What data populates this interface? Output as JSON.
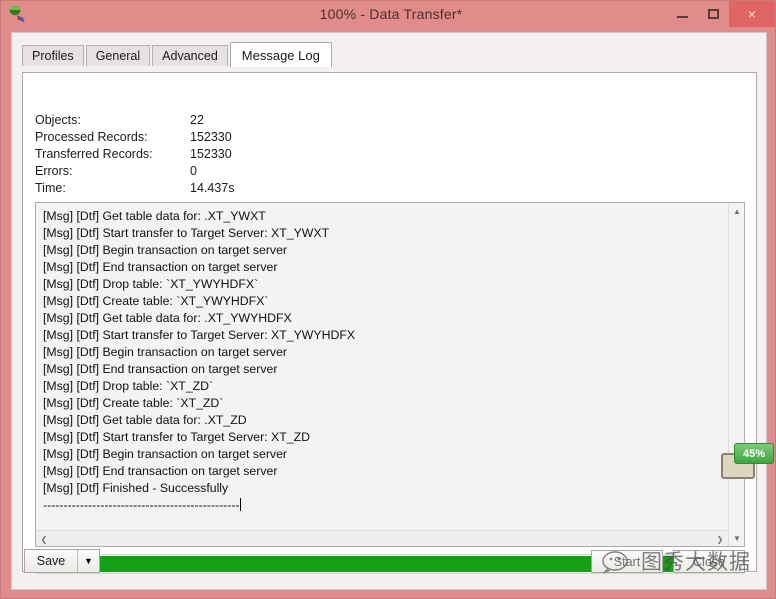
{
  "window": {
    "title": "100% - Data Transfer*",
    "app_icon": "navicat-data-transfer-icon",
    "controls": {
      "minimize": "minimize-icon",
      "maximize": "maximize-icon",
      "close": "×"
    }
  },
  "tabs": [
    {
      "label": "Profiles",
      "active": false
    },
    {
      "label": "General",
      "active": false
    },
    {
      "label": "Advanced",
      "active": false
    },
    {
      "label": "Message Log",
      "active": true
    }
  ],
  "summary": [
    {
      "key": "Objects:",
      "value": "22"
    },
    {
      "key": "Processed Records:",
      "value": "152330"
    },
    {
      "key": "Transferred Records:",
      "value": "152330"
    },
    {
      "key": "Errors:",
      "value": "0"
    },
    {
      "key": "Time:",
      "value": "14.437s"
    }
  ],
  "log": {
    "lines": [
      "[Msg] [Dtf] Get table data for: .XT_YWXT",
      "[Msg] [Dtf] Start transfer to Target Server: XT_YWXT",
      "[Msg] [Dtf] Begin transaction on target server",
      "[Msg] [Dtf] End transaction on target server",
      "[Msg] [Dtf] Drop table: `XT_YWYHDFX`",
      "[Msg] [Dtf] Create table: `XT_YWYHDFX`",
      "[Msg] [Dtf] Get table data for: .XT_YWYHDFX",
      "[Msg] [Dtf] Start transfer to Target Server: XT_YWYHDFX",
      "[Msg] [Dtf] Begin transaction on target server",
      "[Msg] [Dtf] End transaction on target server",
      "[Msg] [Dtf] Drop table: `XT_ZD`",
      "[Msg] [Dtf] Create table: `XT_ZD`",
      "[Msg] [Dtf] Get table data for: .XT_ZD",
      "[Msg] [Dtf] Start transfer to Target Server: XT_ZD",
      "[Msg] [Dtf] Begin transaction on target server",
      "[Msg] [Dtf] End transaction on target server",
      "[Msg] [Dtf] Finished - Successfully",
      "------------------------------------------------"
    ],
    "scrollbar": {
      "up_arrow": "chevron-up-icon",
      "down_arrow": "chevron-down-icon",
      "left_arrow": "chevron-left-icon",
      "right_arrow": "chevron-right-icon"
    }
  },
  "progress": {
    "percent": 100,
    "color": "#15a015"
  },
  "buttons": {
    "save": "Save",
    "save_dropdown": "▼",
    "start": "Start",
    "close": "Close"
  },
  "watermark": {
    "text": "图秀大数据",
    "logo": "wechat-icon"
  },
  "tray": {
    "badge": "45%",
    "icon": "monitor-icon"
  }
}
